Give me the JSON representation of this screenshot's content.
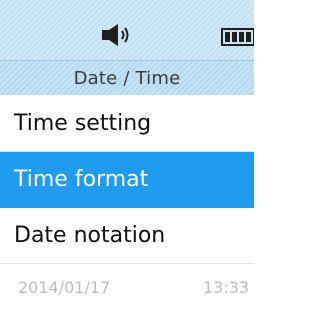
{
  "status_bar": {
    "icons": [
      "speaker-icon",
      "battery-icon"
    ],
    "color": "#cfe7f6"
  },
  "header": {
    "title": "Date / Time"
  },
  "menu": {
    "items": [
      {
        "label": "Time setting",
        "selected": false
      },
      {
        "label": "Time format",
        "selected": true
      },
      {
        "label": "Date notation",
        "selected": false
      }
    ],
    "selected_color": "#1f9cf0"
  },
  "footer": {
    "date": "2014/01/17",
    "time": "13:33"
  }
}
